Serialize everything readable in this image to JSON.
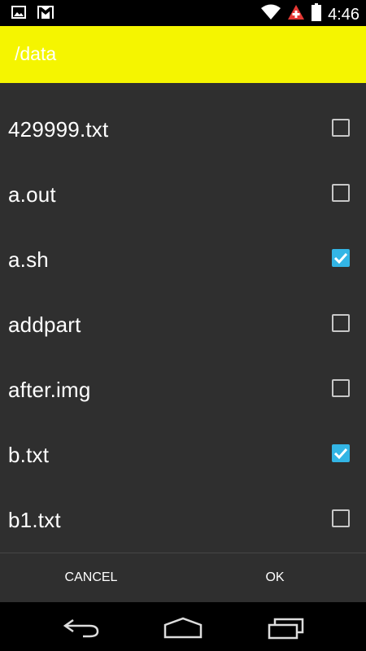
{
  "status_bar": {
    "time": "4:46",
    "icons": [
      "image-notification-icon",
      "gmail-icon",
      "wifi-icon",
      "alert-icon",
      "battery-icon"
    ]
  },
  "dialog": {
    "title": "/data",
    "title_bar_color": "#f5f500",
    "accent_color": "#33b5e5",
    "items": [
      {
        "label": "429999.txt",
        "checked": false
      },
      {
        "label": "a.out",
        "checked": false
      },
      {
        "label": "a.sh",
        "checked": true
      },
      {
        "label": "addpart",
        "checked": false
      },
      {
        "label": "after.img",
        "checked": false
      },
      {
        "label": "b.txt",
        "checked": true
      },
      {
        "label": "b1.txt",
        "checked": false
      }
    ],
    "cancel_label": "CANCEL",
    "ok_label": "OK"
  },
  "nav_bar": {
    "icons": [
      "back-icon",
      "home-icon",
      "recent-apps-icon"
    ]
  }
}
